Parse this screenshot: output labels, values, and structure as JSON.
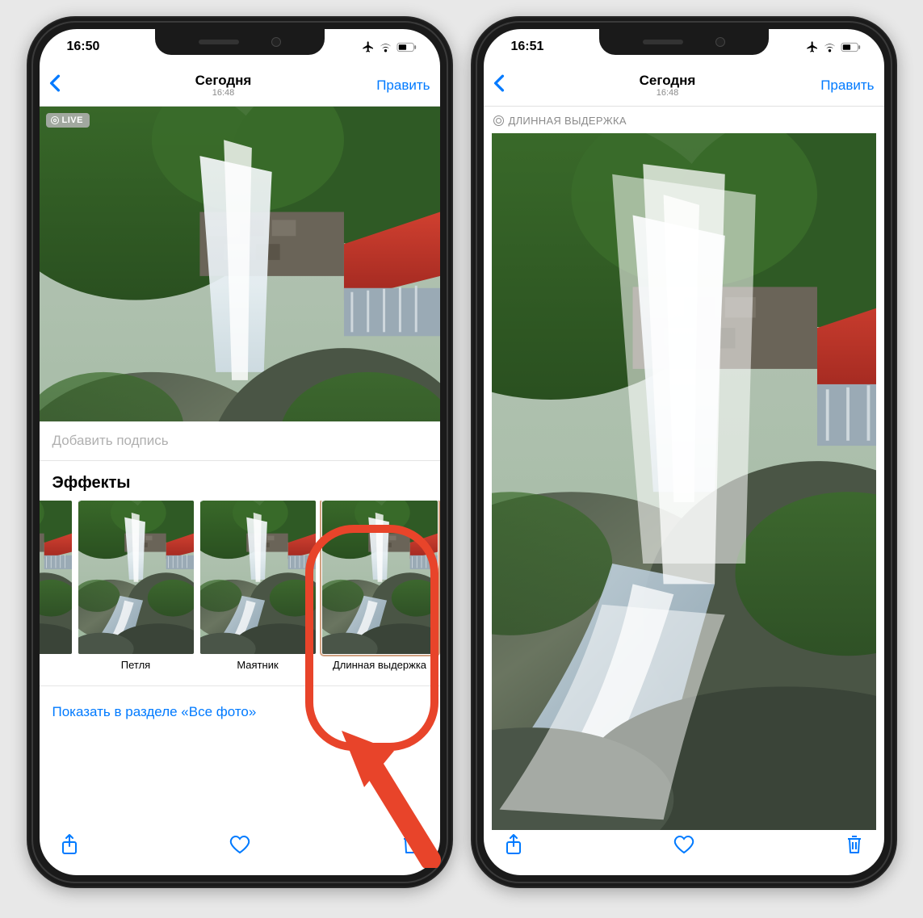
{
  "left": {
    "status": {
      "time": "16:50"
    },
    "nav": {
      "title": "Сегодня",
      "subtitle": "16:48",
      "edit": "Править"
    },
    "live_badge": "LIVE",
    "caption_placeholder": "Добавить подпись",
    "effects_title": "Эффекты",
    "effects": [
      {
        "label": "Петля"
      },
      {
        "label": "Маятник"
      },
      {
        "label": "Длинная выдержка"
      }
    ],
    "show_link": "Показать в разделе «Все фото»"
  },
  "right": {
    "status": {
      "time": "16:51"
    },
    "nav": {
      "title": "Сегодня",
      "subtitle": "16:48",
      "edit": "Править"
    },
    "exposure_badge": "ДЛИННАЯ ВЫДЕРЖКА"
  },
  "icons": {
    "airplane": "airplane",
    "wifi": "wifi",
    "battery": "battery"
  }
}
